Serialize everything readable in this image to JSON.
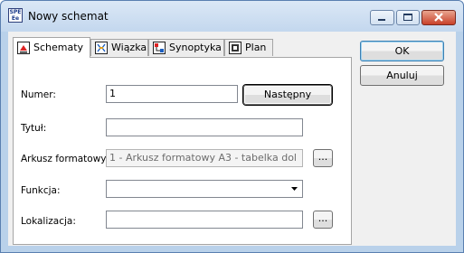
{
  "window": {
    "title": "Nowy schemat",
    "app_icon_text": "SPE Ee"
  },
  "tabs": [
    {
      "label": "Schematy",
      "icon": "schemat-icon"
    },
    {
      "label": "Wiązka",
      "icon": "harness-icon"
    },
    {
      "label": "Synoptyka",
      "icon": "synoptic-icon"
    },
    {
      "label": "Plan",
      "icon": "plan-icon"
    }
  ],
  "form": {
    "numer_label": "Numer:",
    "numer_value": "1",
    "next_button": "Następny",
    "tytul_label": "Tytuł:",
    "tytul_value": "",
    "arkusz_label": "Arkusz formatowy:",
    "arkusz_value": "1 - Arkusz formatowy A3 - tabelka dol",
    "browse_label": "...",
    "funkcja_label": "Funkcja:",
    "funkcja_value": "",
    "lokalizacja_label": "Lokalizacja:",
    "lokalizacja_value": ""
  },
  "buttons": {
    "ok": "OK",
    "cancel": "Anuluj"
  }
}
